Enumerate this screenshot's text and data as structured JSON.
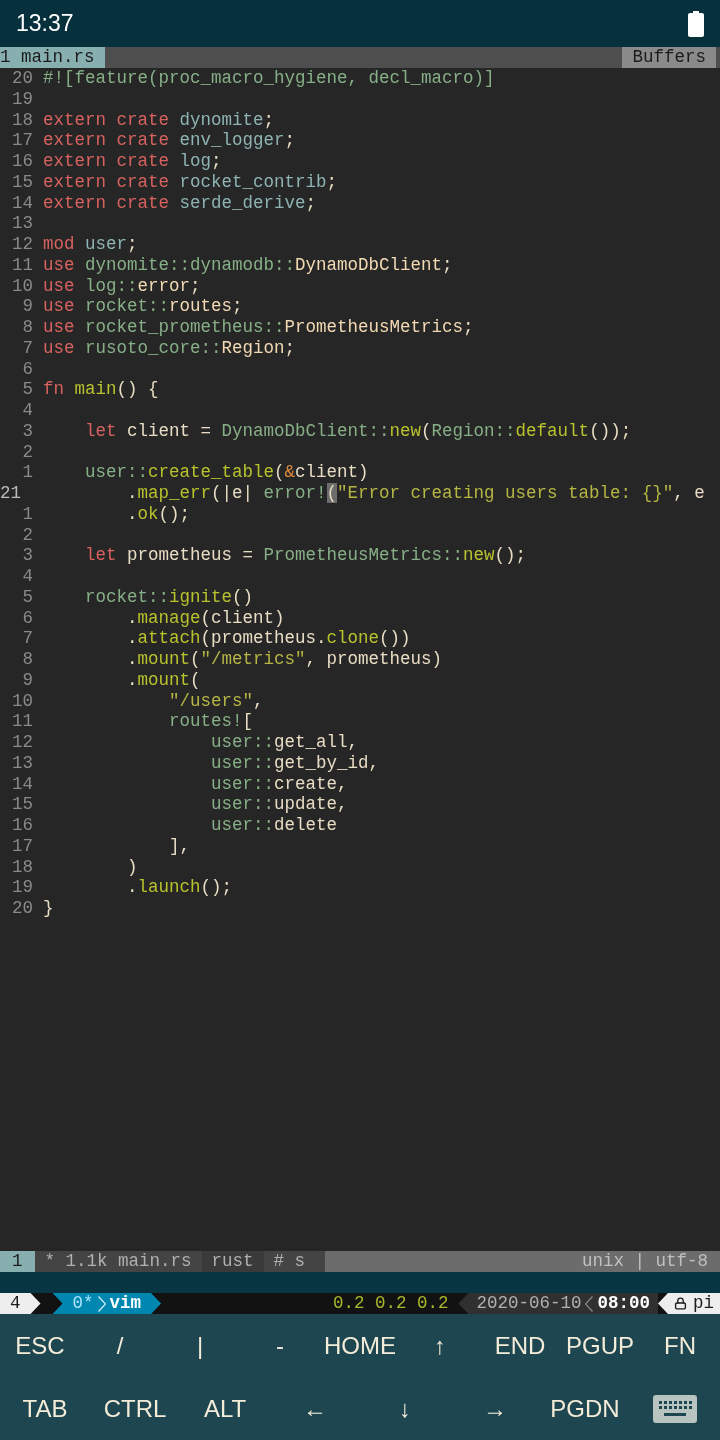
{
  "status_bar": {
    "time": "13:37"
  },
  "tabline": {
    "tab": "1 main.rs",
    "right": "Buffers"
  },
  "code": [
    {
      "number": "20",
      "current": false,
      "tokens": [
        {
          "kind": "attr",
          "text": "#![feature(proc_macro_hygiene, decl_macro)]"
        }
      ]
    },
    {
      "number": "19",
      "current": false
    },
    {
      "number": "18",
      "current": false,
      "tokens": [
        {
          "kind": "keyword",
          "text": "extern crate "
        },
        {
          "kind": "crate",
          "text": "dynomite"
        },
        {
          "kind": "plain",
          "text": ";"
        }
      ]
    },
    {
      "number": "17",
      "current": false,
      "tokens": [
        {
          "kind": "keyword",
          "text": "extern crate "
        },
        {
          "kind": "crate",
          "text": "env_logger"
        },
        {
          "kind": "plain",
          "text": ";"
        }
      ]
    },
    {
      "number": "16",
      "current": false,
      "tokens": [
        {
          "kind": "keyword",
          "text": "extern crate "
        },
        {
          "kind": "crate",
          "text": "log"
        },
        {
          "kind": "plain",
          "text": ";"
        }
      ]
    },
    {
      "number": "15",
      "current": false,
      "tokens": [
        {
          "kind": "keyword",
          "text": "extern crate "
        },
        {
          "kind": "crate",
          "text": "rocket_contrib"
        },
        {
          "kind": "plain",
          "text": ";"
        }
      ]
    },
    {
      "number": "14",
      "current": false,
      "tokens": [
        {
          "kind": "keyword",
          "text": "extern crate "
        },
        {
          "kind": "crate",
          "text": "serde_derive"
        },
        {
          "kind": "plain",
          "text": ";"
        }
      ]
    },
    {
      "number": "13",
      "current": false
    },
    {
      "number": "12",
      "current": false,
      "tokens": [
        {
          "kind": "keyword",
          "text": "mod "
        },
        {
          "kind": "crate",
          "text": "user"
        },
        {
          "kind": "plain",
          "text": ";"
        }
      ]
    },
    {
      "number": "11",
      "current": false,
      "tokens": [
        {
          "kind": "keyword",
          "text": "use "
        },
        {
          "kind": "path",
          "text": "dynomite::dynamodb::"
        },
        {
          "kind": "type",
          "text": "DynamoDbClient"
        },
        {
          "kind": "plain",
          "text": ";"
        }
      ]
    },
    {
      "number": "10",
      "current": false,
      "tokens": [
        {
          "kind": "keyword",
          "text": "use "
        },
        {
          "kind": "path",
          "text": "log::"
        },
        {
          "kind": "type",
          "text": "error"
        },
        {
          "kind": "plain",
          "text": ";"
        }
      ]
    },
    {
      "number": "9",
      "current": false,
      "tokens": [
        {
          "kind": "keyword",
          "text": "use "
        },
        {
          "kind": "path",
          "text": "rocket::"
        },
        {
          "kind": "type",
          "text": "routes"
        },
        {
          "kind": "plain",
          "text": ";"
        }
      ]
    },
    {
      "number": "8",
      "current": false,
      "tokens": [
        {
          "kind": "keyword",
          "text": "use "
        },
        {
          "kind": "path",
          "text": "rocket_prometheus::"
        },
        {
          "kind": "type",
          "text": "PrometheusMetrics"
        },
        {
          "kind": "plain",
          "text": ";"
        }
      ]
    },
    {
      "number": "7",
      "current": false,
      "tokens": [
        {
          "kind": "keyword",
          "text": "use "
        },
        {
          "kind": "path",
          "text": "rusoto_core::"
        },
        {
          "kind": "type",
          "text": "Region"
        },
        {
          "kind": "plain",
          "text": ";"
        }
      ]
    },
    {
      "number": "6",
      "current": false
    },
    {
      "number": "5",
      "current": false,
      "tokens": [
        {
          "kind": "keyword",
          "text": "fn "
        },
        {
          "kind": "func",
          "text": "main"
        },
        {
          "kind": "plain",
          "text": "() {"
        }
      ]
    },
    {
      "number": "4",
      "current": false
    },
    {
      "number": "3",
      "current": false,
      "tokens": [
        {
          "kind": "keyword",
          "text": "    let "
        },
        {
          "kind": "plain",
          "text": "client = "
        },
        {
          "kind": "path",
          "text": "DynamoDbClient::"
        },
        {
          "kind": "func",
          "text": "new"
        },
        {
          "kind": "plain",
          "text": "("
        },
        {
          "kind": "path",
          "text": "Region::"
        },
        {
          "kind": "func",
          "text": "default"
        },
        {
          "kind": "plain",
          "text": "());"
        }
      ]
    },
    {
      "number": "2",
      "current": false
    },
    {
      "number": "1",
      "current": false,
      "tokens": [
        {
          "kind": "path",
          "text": "    user::"
        },
        {
          "kind": "func",
          "text": "create_table"
        },
        {
          "kind": "plain",
          "text": "("
        },
        {
          "kind": "amp",
          "text": "&"
        },
        {
          "kind": "plain",
          "text": "client)"
        }
      ]
    },
    {
      "number": "21",
      "current": true,
      "tokens": [
        {
          "kind": "plain",
          "text": "        ."
        },
        {
          "kind": "func",
          "text": "map_err"
        },
        {
          "kind": "plain",
          "text": "(|e| "
        },
        {
          "kind": "path",
          "text": "error!"
        },
        {
          "kind": "cursor",
          "text": "("
        },
        {
          "kind": "string",
          "text": "\"Error creating users table: {}\""
        },
        {
          "kind": "plain",
          "text": ", e"
        }
      ]
    },
    {
      "number": "1",
      "current": false,
      "tokens": [
        {
          "kind": "plain",
          "text": "        ."
        },
        {
          "kind": "func",
          "text": "ok"
        },
        {
          "kind": "plain",
          "text": "();"
        }
      ]
    },
    {
      "number": "2",
      "current": false
    },
    {
      "number": "3",
      "current": false,
      "tokens": [
        {
          "kind": "keyword",
          "text": "    let "
        },
        {
          "kind": "plain",
          "text": "prometheus = "
        },
        {
          "kind": "path",
          "text": "PrometheusMetrics::"
        },
        {
          "kind": "func",
          "text": "new"
        },
        {
          "kind": "plain",
          "text": "();"
        }
      ]
    },
    {
      "number": "4",
      "current": false
    },
    {
      "number": "5",
      "current": false,
      "tokens": [
        {
          "kind": "path",
          "text": "    rocket::"
        },
        {
          "kind": "func",
          "text": "ignite"
        },
        {
          "kind": "plain",
          "text": "()"
        }
      ]
    },
    {
      "number": "6",
      "current": false,
      "tokens": [
        {
          "kind": "plain",
          "text": "        ."
        },
        {
          "kind": "func",
          "text": "manage"
        },
        {
          "kind": "plain",
          "text": "(client)"
        }
      ]
    },
    {
      "number": "7",
      "current": false,
      "tokens": [
        {
          "kind": "plain",
          "text": "        ."
        },
        {
          "kind": "func",
          "text": "attach"
        },
        {
          "kind": "plain",
          "text": "(prometheus."
        },
        {
          "kind": "func",
          "text": "clone"
        },
        {
          "kind": "plain",
          "text": "())"
        }
      ]
    },
    {
      "number": "8",
      "current": false,
      "tokens": [
        {
          "kind": "plain",
          "text": "        ."
        },
        {
          "kind": "func",
          "text": "mount"
        },
        {
          "kind": "plain",
          "text": "("
        },
        {
          "kind": "string",
          "text": "\"/metrics\""
        },
        {
          "kind": "plain",
          "text": ", prometheus)"
        }
      ]
    },
    {
      "number": "9",
      "current": false,
      "tokens": [
        {
          "kind": "plain",
          "text": "        ."
        },
        {
          "kind": "func",
          "text": "mount"
        },
        {
          "kind": "plain",
          "text": "("
        }
      ]
    },
    {
      "number": "10",
      "current": false,
      "tokens": [
        {
          "kind": "string",
          "text": "            \"/users\""
        },
        {
          "kind": "plain",
          "text": ","
        }
      ]
    },
    {
      "number": "11",
      "current": false,
      "tokens": [
        {
          "kind": "path",
          "text": "            routes!"
        },
        {
          "kind": "plain",
          "text": "["
        }
      ]
    },
    {
      "number": "12",
      "current": false,
      "tokens": [
        {
          "kind": "path",
          "text": "                user::"
        },
        {
          "kind": "plain",
          "text": "get_all,"
        }
      ]
    },
    {
      "number": "13",
      "current": false,
      "tokens": [
        {
          "kind": "path",
          "text": "                user::"
        },
        {
          "kind": "plain",
          "text": "get_by_id,"
        }
      ]
    },
    {
      "number": "14",
      "current": false,
      "tokens": [
        {
          "kind": "path",
          "text": "                user::"
        },
        {
          "kind": "plain",
          "text": "create,"
        }
      ]
    },
    {
      "number": "15",
      "current": false,
      "tokens": [
        {
          "kind": "path",
          "text": "                user::"
        },
        {
          "kind": "plain",
          "text": "update,"
        }
      ]
    },
    {
      "number": "16",
      "current": false,
      "tokens": [
        {
          "kind": "path",
          "text": "                user::"
        },
        {
          "kind": "plain",
          "text": "delete"
        }
      ]
    },
    {
      "number": "17",
      "current": false,
      "tokens": [
        {
          "kind": "plain",
          "text": "            ],"
        }
      ]
    },
    {
      "number": "18",
      "current": false,
      "tokens": [
        {
          "kind": "plain",
          "text": "        )"
        }
      ]
    },
    {
      "number": "19",
      "current": false,
      "tokens": [
        {
          "kind": "plain",
          "text": "        ."
        },
        {
          "kind": "func",
          "text": "launch"
        },
        {
          "kind": "plain",
          "text": "();"
        }
      ]
    },
    {
      "number": "20",
      "current": false,
      "tokens": [
        {
          "kind": "plain",
          "text": "}"
        }
      ]
    }
  ],
  "statusline": {
    "mode": "1",
    "file": "* 1.1k main.rs",
    "filetype": "rust",
    "extra": "# s",
    "format": "unix | utf-8"
  },
  "tmux": {
    "session": "4",
    "window_index": "0*",
    "window_name": "vim",
    "load": "0.2 0.2 0.2",
    "date": "2020-06-10",
    "time": "08:00",
    "host": "pi"
  },
  "extra_keys": [
    [
      {
        "kind": "text",
        "label": "ESC"
      },
      {
        "kind": "text",
        "label": "/"
      },
      {
        "kind": "text",
        "label": "|"
      },
      {
        "kind": "text",
        "label": "-"
      },
      {
        "kind": "text",
        "label": "HOME"
      },
      {
        "kind": "text",
        "label": "↑"
      },
      {
        "kind": "text",
        "label": "END"
      },
      {
        "kind": "text",
        "label": "PGUP"
      },
      {
        "kind": "text",
        "label": "FN"
      }
    ],
    [
      {
        "kind": "text",
        "label": "TAB"
      },
      {
        "kind": "text",
        "label": "CTRL"
      },
      {
        "kind": "text",
        "label": "ALT"
      },
      {
        "kind": "text",
        "label": "←"
      },
      {
        "kind": "text",
        "label": "↓"
      },
      {
        "kind": "text",
        "label": "→"
      },
      {
        "kind": "text",
        "label": "PGDN"
      },
      {
        "kind": "keyboard"
      }
    ]
  ]
}
